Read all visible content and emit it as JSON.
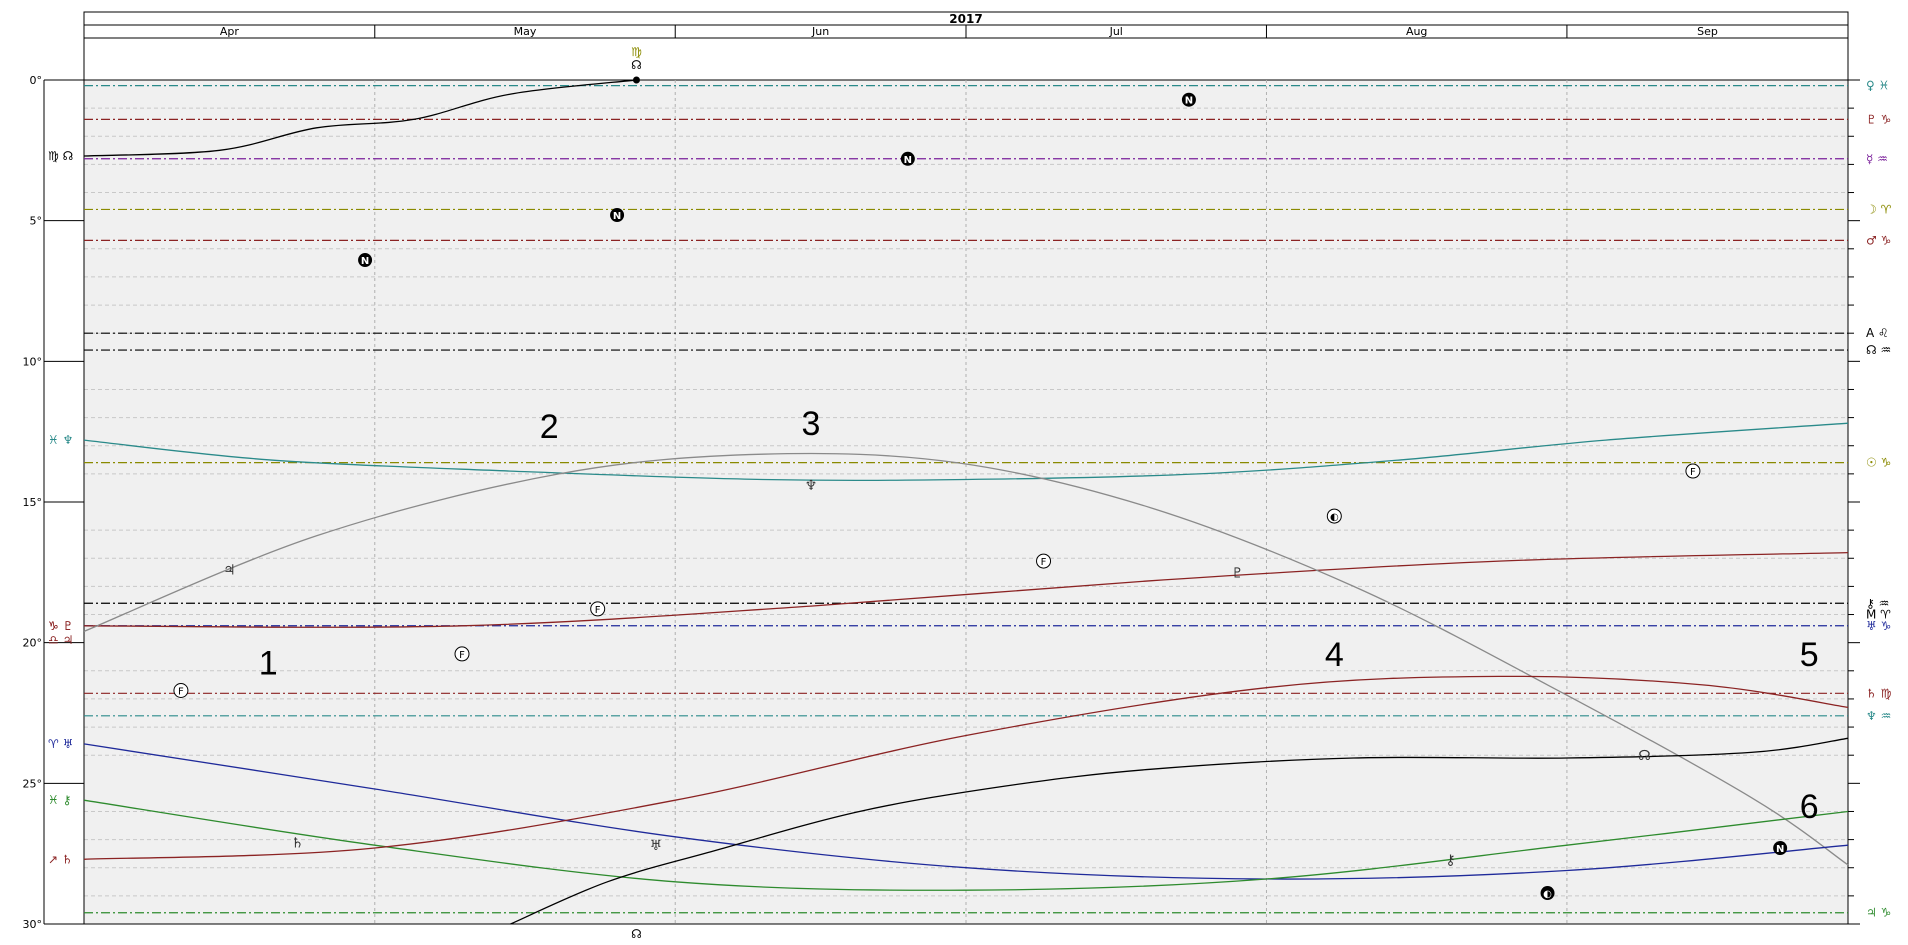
{
  "chart_data": {
    "type": "line",
    "title": "2017",
    "months": [
      "Apr",
      "May",
      "Jun",
      "Jul",
      "Aug",
      "Sep"
    ],
    "x_range": [
      "2017-04-01",
      "2017-09-30"
    ],
    "ylim": [
      0,
      30
    ],
    "yaxis_direction": "down",
    "yticks": [
      "0°",
      "5°",
      "10°",
      "15°",
      "20°",
      "25°",
      "30°"
    ],
    "grid": true,
    "colors": {
      "background": "#f0f0f0",
      "teal": "#2a8a8a",
      "brown": "#8b2323",
      "gray": "#8a8a8a",
      "blue": "#1f2a9a",
      "green": "#2e8b2e",
      "black": "#000000"
    },
    "reference_lines": [
      {
        "y": 0.2,
        "left_label": "",
        "right_label": "♀ ♓",
        "color": "#2a8a8a"
      },
      {
        "y": 1.4,
        "left_label": "",
        "right_label": "♇ ♑",
        "color": "#8b2323"
      },
      {
        "y": 2.8,
        "left_label": "",
        "right_label": "☿ ♒",
        "color": "#7a1f9a"
      },
      {
        "y": 4.6,
        "left_label": "",
        "right_label": "☽ ♈",
        "color": "#8a8a00"
      },
      {
        "y": 5.7,
        "left_label": "",
        "right_label": "♂ ♑",
        "color": "#8b2323"
      },
      {
        "y": 9.0,
        "left_label": "",
        "right_label": "A ♌",
        "color": "#000000"
      },
      {
        "y": 9.6,
        "left_label": "",
        "right_label": "☊ ♒",
        "color": "#000000"
      },
      {
        "y": 13.6,
        "left_label": "",
        "right_label": "☉ ♑",
        "color": "#8a8a00"
      },
      {
        "y": 18.6,
        "left_label": "",
        "right_label": "⚷ ♒",
        "color": "#000000"
      },
      {
        "y": 19.4,
        "left_label": "",
        "right_label": "♅ ♑",
        "color": "#1f2a9a"
      },
      {
        "y": 21.8,
        "left_label": "",
        "right_label": "♄ ♍",
        "color": "#8b2323"
      },
      {
        "y": 22.6,
        "left_label": "",
        "right_label": "♆ ♒",
        "color": "#2a8a8a"
      },
      {
        "y": 29.6,
        "left_label": "",
        "right_label": "♃ ♑",
        "color": "#2e8b2e"
      }
    ],
    "extra_right_label": {
      "y": 19.0,
      "text": "M ♈"
    },
    "series": [
      {
        "name": "",
        "label": "♍ ☊",
        "color": "#000000",
        "x": [
          "2017-04-01",
          "2017-04-15",
          "2017-04-25",
          "2017-05-05",
          "2017-05-15",
          "2017-05-28"
        ],
        "y": [
          2.7,
          2.5,
          1.7,
          1.4,
          0.5,
          0.0
        ]
      },
      {
        "name": "",
        "label": "♓ ♆",
        "color": "#2a8a8a",
        "x": [
          "2017-04-01",
          "2017-04-20",
          "2017-05-15",
          "2017-06-10",
          "2017-07-01",
          "2017-07-25",
          "2017-08-15",
          "2017-09-05",
          "2017-09-30"
        ],
        "y": [
          12.8,
          13.5,
          13.9,
          14.2,
          14.2,
          14.0,
          13.5,
          12.8,
          12.2
        ]
      },
      {
        "name": "",
        "label": "♑ ♇",
        "color": "#8b2323",
        "x": [
          "2017-04-01",
          "2017-05-10",
          "2017-06-15",
          "2017-07-20",
          "2017-08-25",
          "2017-09-30"
        ],
        "y": [
          19.4,
          19.4,
          18.7,
          17.8,
          17.1,
          16.8
        ]
      },
      {
        "name": "",
        "label": "",
        "color": "#8a8a8a",
        "x": [
          "2017-04-01",
          "2017-04-25",
          "2017-05-20",
          "2017-06-10",
          "2017-06-30",
          "2017-07-20",
          "2017-08-10",
          "2017-08-30",
          "2017-09-20",
          "2017-09-30"
        ],
        "y": [
          19.6,
          16.2,
          14.0,
          13.3,
          13.6,
          15.2,
          18.0,
          21.5,
          25.5,
          27.9
        ]
      },
      {
        "name": "",
        "label": "♈ ♅",
        "color": "#1f2a9a",
        "x": [
          "2017-04-01",
          "2017-05-01",
          "2017-06-01",
          "2017-07-01",
          "2017-08-01",
          "2017-09-01",
          "2017-09-30"
        ],
        "y": [
          23.6,
          25.2,
          26.9,
          28.0,
          28.4,
          28.1,
          27.2
        ]
      },
      {
        "name": "",
        "label": "♓ ⚷",
        "color": "#2e8b2e",
        "x": [
          "2017-04-01",
          "2017-05-01",
          "2017-06-01",
          "2017-07-01",
          "2017-08-01",
          "2017-09-01",
          "2017-09-30"
        ],
        "y": [
          25.6,
          27.2,
          28.5,
          28.8,
          28.4,
          27.2,
          26.0
        ]
      },
      {
        "name": "",
        "label": "↗ ♄",
        "color": "#8b2323",
        "x": [
          "2017-04-01",
          "2017-05-01",
          "2017-06-01",
          "2017-07-01",
          "2017-08-01",
          "2017-08-25",
          "2017-09-15",
          "2017-09-30"
        ],
        "y": [
          27.7,
          27.3,
          25.6,
          23.3,
          21.6,
          21.2,
          21.5,
          22.3
        ]
      },
      {
        "name": "",
        "label": "",
        "color": "#000000",
        "x": [
          "2017-05-15",
          "2017-05-25",
          "2017-06-05",
          "2017-06-20",
          "2017-07-05",
          "2017-07-20",
          "2017-08-10",
          "2017-09-01",
          "2017-09-20",
          "2017-09-30"
        ],
        "y": [
          30.0,
          28.5,
          27.4,
          26.0,
          25.1,
          24.5,
          24.1,
          24.1,
          23.9,
          23.4
        ]
      }
    ],
    "annotations": [
      {
        "text": "1",
        "x": "2017-04-20",
        "y": 20.7
      },
      {
        "text": "2",
        "x": "2017-05-19",
        "y": 12.3
      },
      {
        "text": "3",
        "x": "2017-06-15",
        "y": 12.2
      },
      {
        "text": "4",
        "x": "2017-08-08",
        "y": 20.4
      },
      {
        "text": "5",
        "x": "2017-09-26",
        "y": 20.4
      },
      {
        "text": "6",
        "x": "2017-09-26",
        "y": 25.8
      }
    ],
    "markers": [
      {
        "symbol": "N",
        "x": "2017-04-30",
        "y": 6.4,
        "style": "filled"
      },
      {
        "symbol": "N",
        "x": "2017-05-26",
        "y": 4.8,
        "style": "filled"
      },
      {
        "symbol": "N",
        "x": "2017-06-25",
        "y": 2.8,
        "style": "filled"
      },
      {
        "symbol": "N",
        "x": "2017-07-24",
        "y": 0.7,
        "style": "filled"
      },
      {
        "symbol": "N",
        "x": "2017-09-23",
        "y": 27.3,
        "style": "filled"
      },
      {
        "symbol": "F",
        "x": "2017-05-10",
        "y": 20.4,
        "style": "open"
      },
      {
        "symbol": "F",
        "x": "2017-04-11",
        "y": 21.7,
        "style": "open"
      },
      {
        "symbol": "F",
        "x": "2017-05-24",
        "y": 18.8,
        "style": "open"
      },
      {
        "symbol": "F",
        "x": "2017-07-09",
        "y": 17.1,
        "style": "open"
      },
      {
        "symbol": "F",
        "x": "2017-09-14",
        "y": 13.9,
        "style": "open"
      },
      {
        "symbol": "◐",
        "x": "2017-08-08",
        "y": 15.5,
        "style": "open"
      },
      {
        "symbol": "◐",
        "x": "2017-08-30",
        "y": 28.9,
        "style": "filled"
      },
      {
        "symbol": "♆",
        "x": "2017-06-15",
        "y": 14.4,
        "style": "glyph"
      },
      {
        "symbol": "♇",
        "x": "2017-07-29",
        "y": 17.5,
        "style": "glyph"
      },
      {
        "symbol": "♄",
        "x": "2017-04-23",
        "y": 27.1,
        "style": "glyph"
      },
      {
        "symbol": "♅",
        "x": "2017-05-30",
        "y": 27.2,
        "style": "glyph"
      },
      {
        "symbol": "⚷",
        "x": "2017-08-20",
        "y": 27.7,
        "style": "glyph"
      },
      {
        "symbol": "♃",
        "x": "2017-04-16",
        "y": 17.4,
        "style": "glyph"
      },
      {
        "symbol": "☊",
        "x": "2017-09-09",
        "y": 24.0,
        "style": "glyph"
      }
    ],
    "top_glyphs": [
      "♍",
      "☊"
    ],
    "bottom_glyph": "☊",
    "extra_left_labels": [
      {
        "y": 19.4,
        "text": "♑ ♇"
      },
      {
        "y": 19.9,
        "text": "♎ ♃"
      }
    ]
  }
}
